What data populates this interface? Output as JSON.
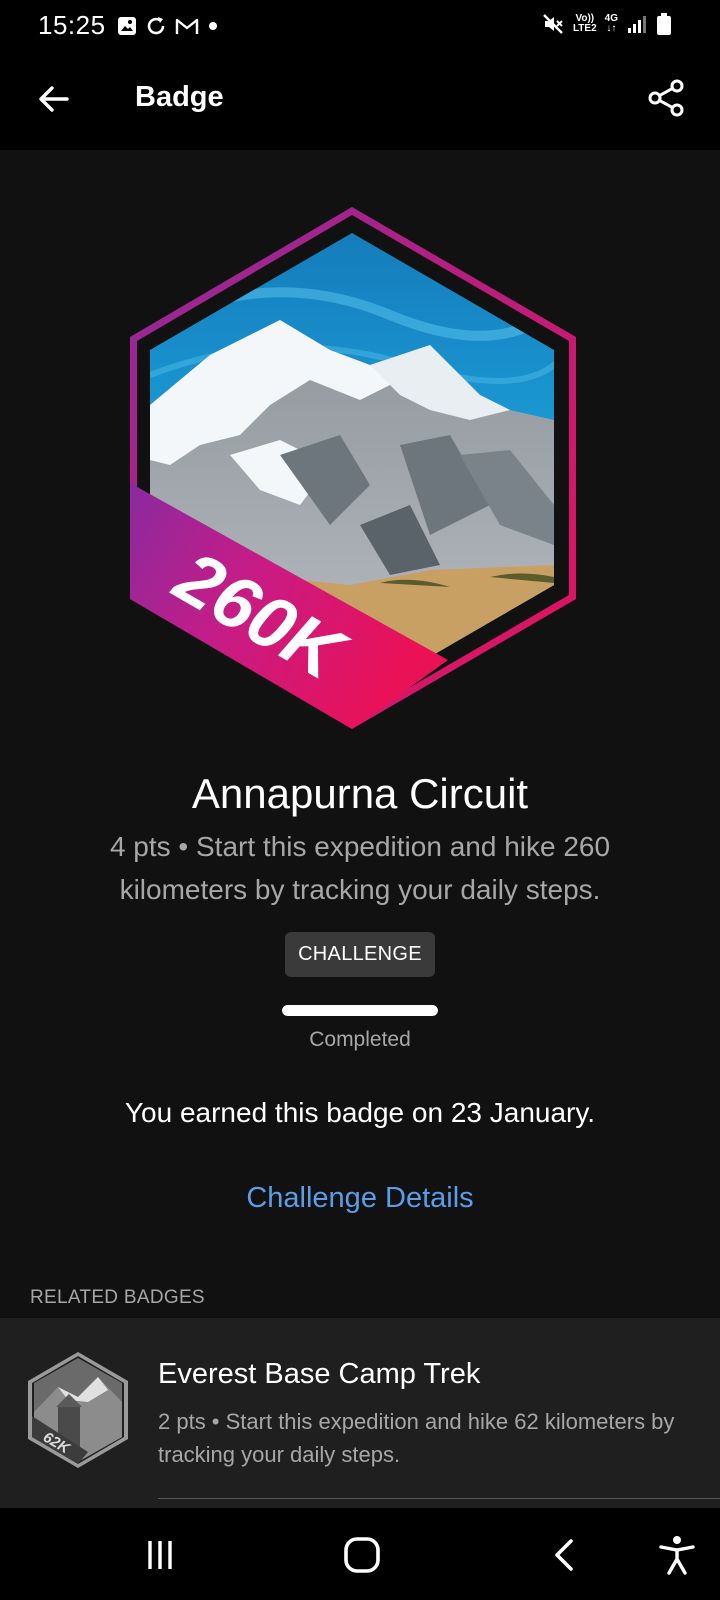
{
  "status_bar": {
    "time": "15:25",
    "left_icons": [
      "gallery-icon",
      "sync-icon",
      "gmail-icon",
      "dot-icon"
    ],
    "right_icons": [
      "mute-icon",
      "volte-icon",
      "4g-icon",
      "signal-icon",
      "battery-icon"
    ],
    "volte_top": "Vo))",
    "volte_bottom": "LTE2",
    "net_type": "4G"
  },
  "app_bar": {
    "title": "Badge"
  },
  "badge": {
    "banner_text": "260K",
    "title": "Annapurna Circuit",
    "description": "4 pts • Start this expedition and hike 260 kilometers by tracking your daily steps.",
    "chip_label": "CHALLENGE",
    "progress_fraction": 1.0,
    "progress_label": "Completed",
    "earned_text": "You earned this badge on 23 January.",
    "details_link": "Challenge Details"
  },
  "related": {
    "header": "RELATED BADGES",
    "items": [
      {
        "banner_text": "62K",
        "title": "Everest Base Camp Trek",
        "description": "2 pts • Start this expedition and hike 62 kilometers by tracking your daily steps."
      }
    ]
  },
  "colors": {
    "background": "#111111",
    "link": "#5a9de8",
    "badge_border_start": "#8e2a9c",
    "badge_border_end": "#e8115a"
  }
}
